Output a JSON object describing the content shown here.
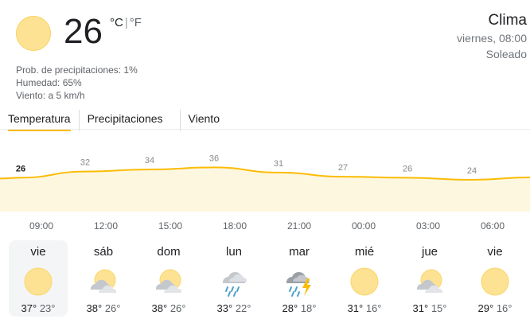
{
  "current": {
    "temperature": "26",
    "unit_c": "°C",
    "unit_f": "°F",
    "precipitation": "Prob. de precipitaciones: 1%",
    "humidity": "Humedad: 65%",
    "wind": "Viento: a 5 km/h",
    "icon": "sun-icon"
  },
  "header": {
    "title": "Clima",
    "datetime": "viernes, 08:00",
    "condition": "Soleado"
  },
  "tabs": [
    {
      "label": "Temperatura",
      "selected": true
    },
    {
      "label": "Precipitaciones",
      "selected": false
    },
    {
      "label": "Viento",
      "selected": false
    }
  ],
  "colors": {
    "accent": "#fbbc04",
    "fill": "#fef7e0",
    "sun": "#fde293"
  },
  "chart_data": {
    "type": "area",
    "x": [
      "09:00",
      "12:00",
      "15:00",
      "18:00",
      "21:00",
      "00:00",
      "03:00",
      "06:00"
    ],
    "values": [
      26,
      32,
      34,
      36,
      31,
      27,
      26,
      24
    ],
    "labels": [
      "26",
      "32",
      "34",
      "36",
      "31",
      "27",
      "26",
      "24"
    ]
  },
  "forecast": [
    {
      "day": "vie",
      "hi": "37°",
      "lo": "23°",
      "icon": "sun-icon",
      "selected": true
    },
    {
      "day": "sáb",
      "hi": "38°",
      "lo": "26°",
      "icon": "partly-cloudy-icon",
      "selected": false
    },
    {
      "day": "dom",
      "hi": "38°",
      "lo": "26°",
      "icon": "partly-cloudy-icon",
      "selected": false
    },
    {
      "day": "lun",
      "hi": "33°",
      "lo": "22°",
      "icon": "rain-icon",
      "selected": false
    },
    {
      "day": "mar",
      "hi": "28°",
      "lo": "18°",
      "icon": "thunderstorm-icon",
      "selected": false
    },
    {
      "day": "mié",
      "hi": "31°",
      "lo": "16°",
      "icon": "sun-icon",
      "selected": false
    },
    {
      "day": "jue",
      "hi": "31°",
      "lo": "15°",
      "icon": "partly-cloudy-icon",
      "selected": false
    },
    {
      "day": "vie",
      "hi": "29°",
      "lo": "16°",
      "icon": "sun-icon",
      "selected": false
    }
  ]
}
